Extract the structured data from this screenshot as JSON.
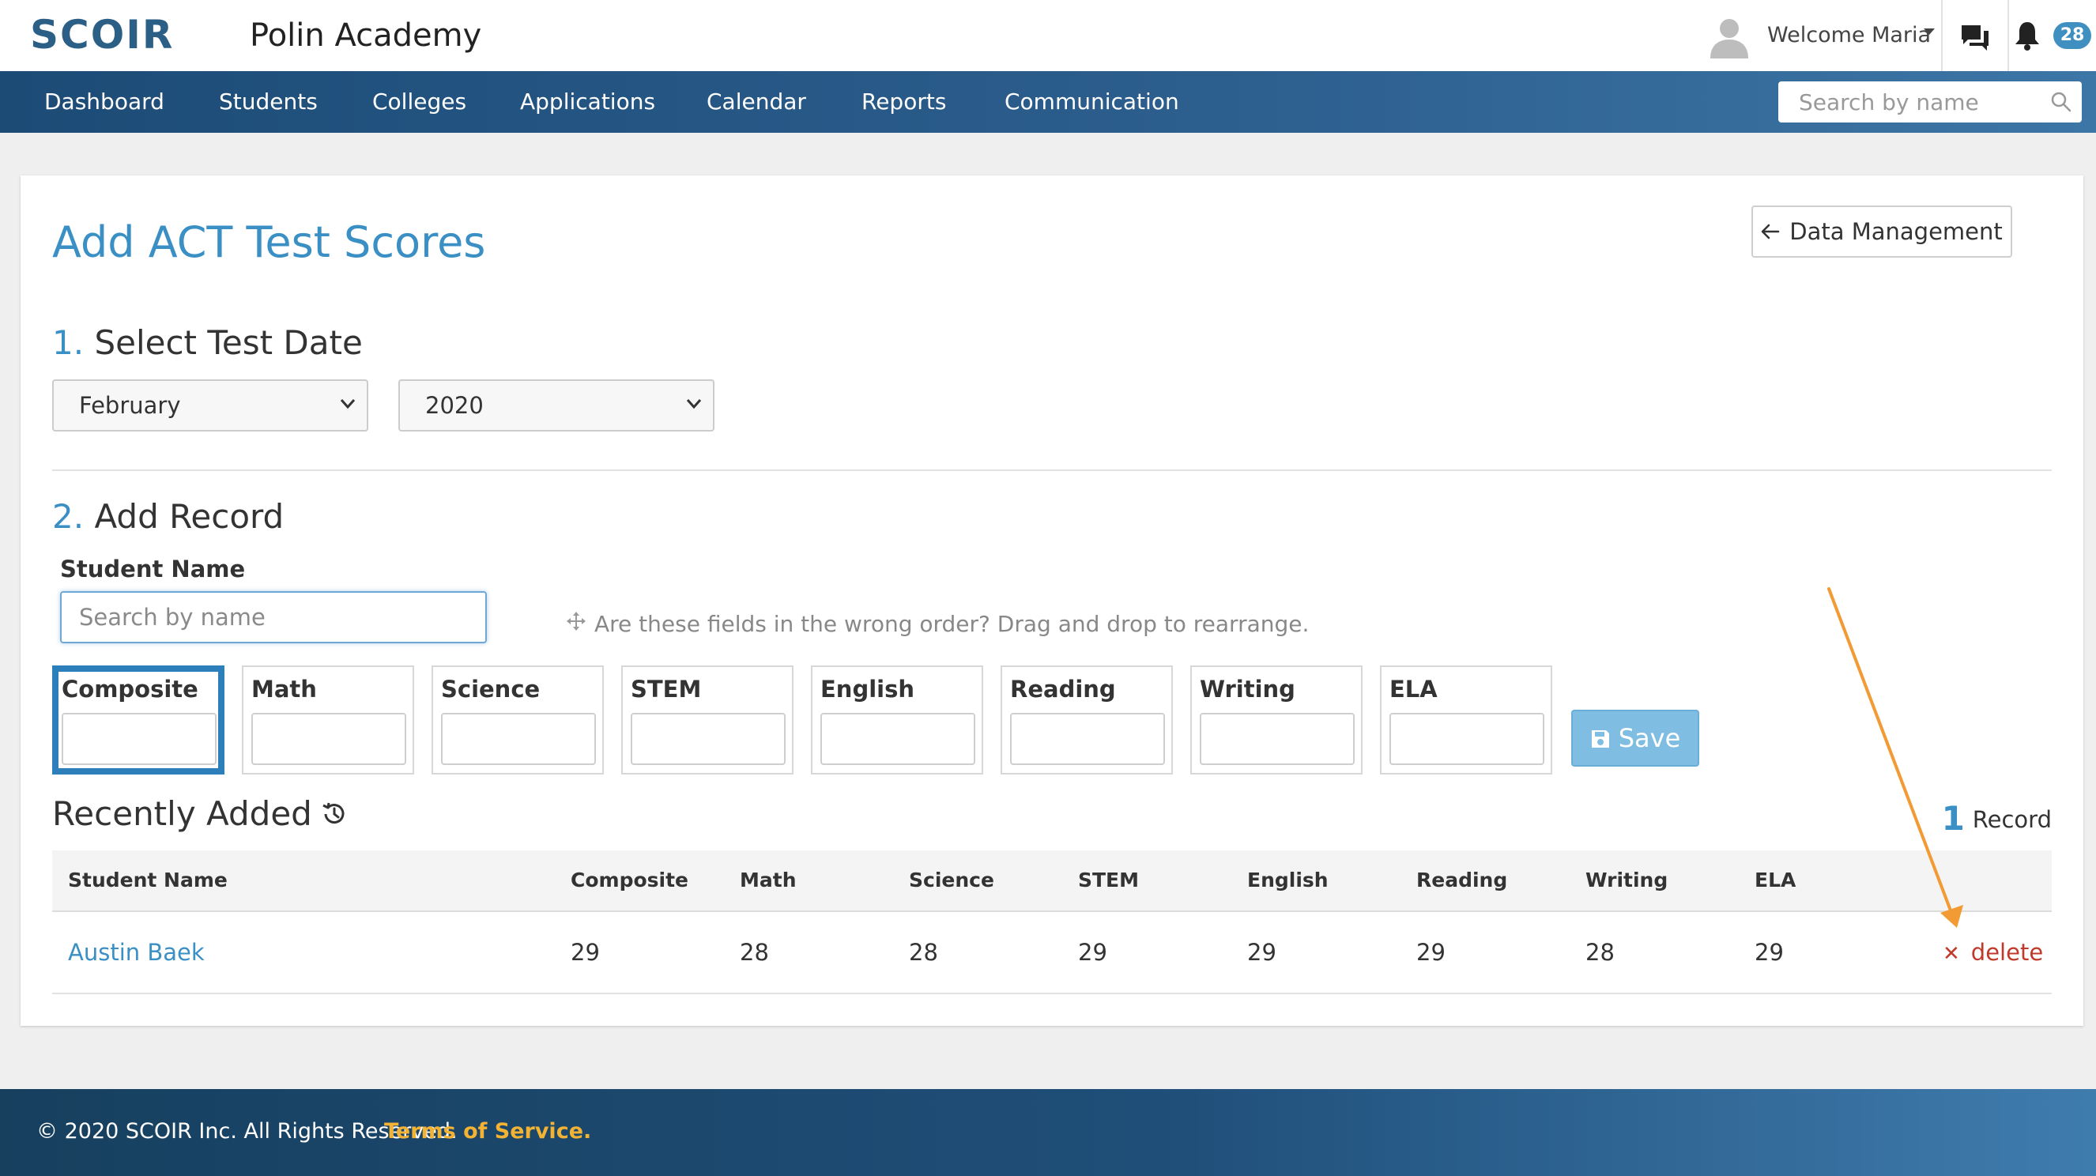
{
  "header": {
    "logo_text": "SCOIR",
    "school_name": "Polin Academy",
    "welcome_text": "Welcome Maria",
    "notification_count": "28"
  },
  "nav": {
    "items": [
      "Dashboard",
      "Students",
      "Colleges",
      "Applications",
      "Calendar",
      "Reports",
      "Communication"
    ],
    "search_placeholder": "Search by name"
  },
  "page": {
    "title": "Add ACT Test Scores",
    "data_management_label": "Data Management"
  },
  "step1": {
    "number": "1.",
    "title": "Select Test Date",
    "month_value": "February",
    "year_value": "2020"
  },
  "step2": {
    "number": "2.",
    "title": "Add Record",
    "student_label": "Student Name",
    "student_placeholder": "Search by name",
    "hint": "Are these fields in the wrong order? Drag and drop to rearrange.",
    "score_fields": [
      "Composite",
      "Math",
      "Science",
      "STEM",
      "English",
      "Reading",
      "Writing",
      "ELA"
    ],
    "save_label": "Save"
  },
  "recent": {
    "title": "Recently Added",
    "record_count": "1",
    "record_label": "Record",
    "columns": [
      "Student Name",
      "Composite",
      "Math",
      "Science",
      "STEM",
      "English",
      "Reading",
      "Writing",
      "ELA"
    ],
    "rows": [
      {
        "student": "Austin Baek",
        "scores": [
          "29",
          "28",
          "28",
          "29",
          "29",
          "29",
          "28",
          "29"
        ],
        "delete_label": "delete"
      }
    ]
  },
  "footer": {
    "copyright": "© 2020 SCOIR Inc. All Rights Reserved.",
    "terms": "Terms of Service."
  },
  "colors": {
    "brand_blue": "#2b5f86",
    "accent_blue": "#3a8fc4",
    "annotation_orange": "#f29a33",
    "delete_red": "#c0392b",
    "terms_gold": "#f2b233"
  }
}
